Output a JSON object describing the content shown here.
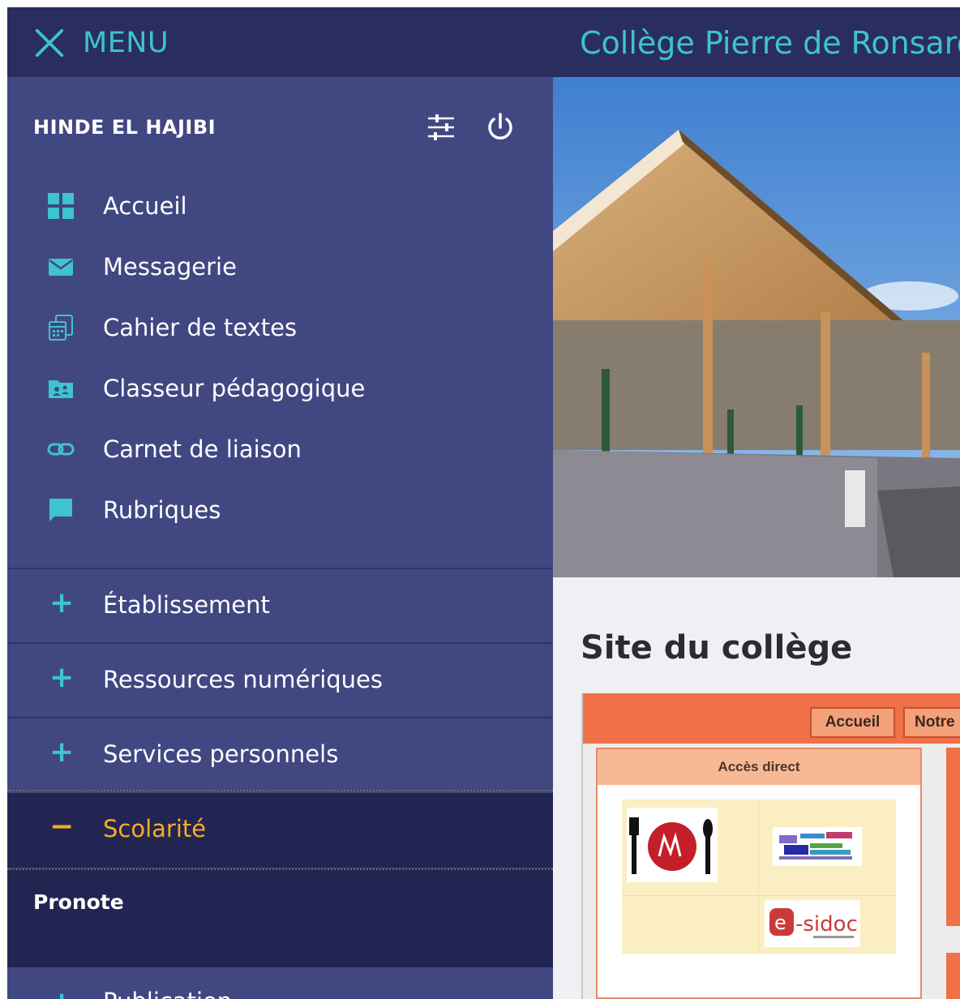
{
  "menu": {
    "label": "MENU",
    "close_icon": "close-icon"
  },
  "user": {
    "name": "HINDE EL HAJIBI",
    "settings_icon": "settings-sliders-icon",
    "power_icon": "power-icon"
  },
  "nav": {
    "items": [
      {
        "label": "Accueil",
        "icon": "dashboard-grid-icon"
      },
      {
        "label": "Messagerie",
        "icon": "envelope-icon"
      },
      {
        "label": "Cahier de textes",
        "icon": "notebook-calendar-icon"
      },
      {
        "label": "Classeur pédagogique",
        "icon": "folder-shared-icon"
      },
      {
        "label": "Carnet de liaison",
        "icon": "link-icon"
      },
      {
        "label": "Rubriques",
        "icon": "chat-bubble-icon"
      }
    ]
  },
  "sections": [
    {
      "label": "Établissement",
      "sign": "+",
      "expanded": false
    },
    {
      "label": "Ressources numériques",
      "sign": "+",
      "expanded": false
    },
    {
      "label": "Services personnels",
      "sign": "+",
      "expanded": false
    },
    {
      "label": "Scolarité",
      "sign": "−",
      "expanded": true,
      "children": [
        "Pronote"
      ]
    },
    {
      "label": "Publication",
      "sign": "+",
      "expanded": false
    }
  ],
  "main": {
    "school_title": "Collège Pierre de Ronsard",
    "site_title": "Site du collège",
    "thumbnail": {
      "nav_buttons": [
        "Accueil",
        "Notre"
      ],
      "panel_title": "Accès direct"
    }
  },
  "colors": {
    "accent_teal": "#3ec3d0",
    "active_orange": "#f4ad23",
    "sidebar_bg": "#414781",
    "header_bg": "#2a2e5e"
  }
}
